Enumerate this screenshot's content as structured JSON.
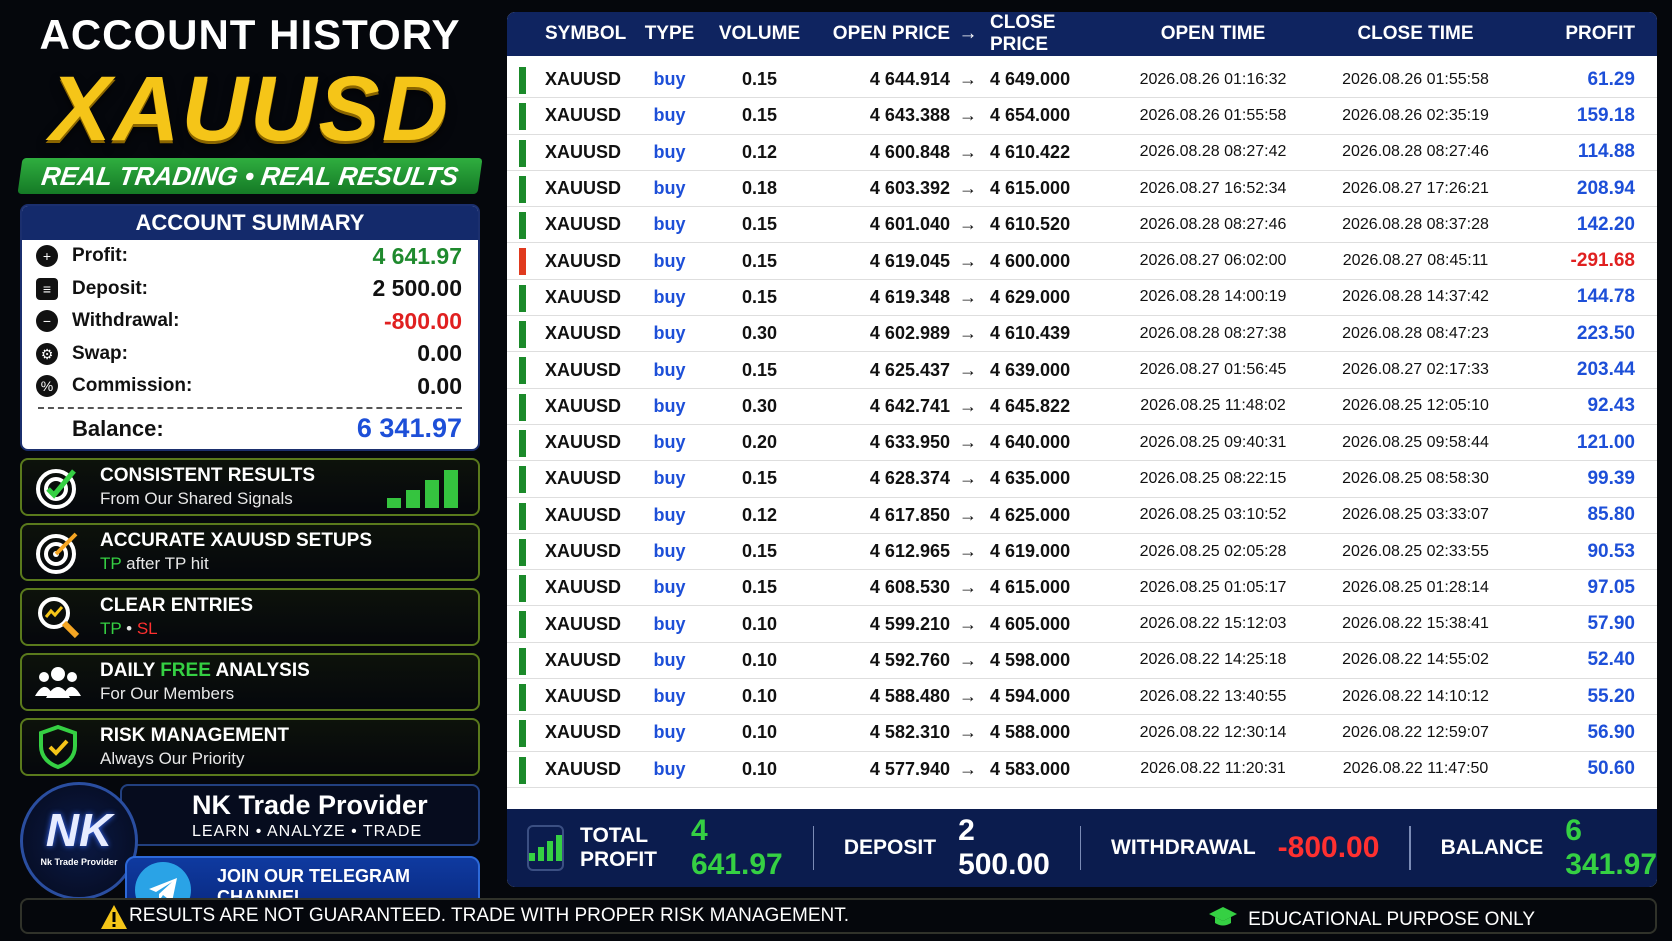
{
  "header": {
    "title": "ACCOUNT HISTORY",
    "symbol": "XAUUSD",
    "tagline": "REAL TRADING • REAL RESULTS"
  },
  "summary": {
    "heading": "ACCOUNT SUMMARY",
    "profit_label": "Profit:",
    "profit": "4 641.97",
    "deposit_label": "Deposit:",
    "deposit": "2 500.00",
    "withdrawal_label": "Withdrawal:",
    "withdrawal": "-800.00",
    "swap_label": "Swap:",
    "swap": "0.00",
    "commission_label": "Commission:",
    "commission": "0.00",
    "balance_label": "Balance:",
    "balance": "6 341.97"
  },
  "features": {
    "f1_title": "CONSISTENT RESULTS",
    "f1_sub": "From Our Shared Signals",
    "f2_title": "ACCURATE XAUUSD SETUPS",
    "f2_tp": "TP",
    "f2_sub": "after TP hit",
    "f3_title": "CLEAR ENTRIES",
    "f3_tp": "TP",
    "f3_dot": "•",
    "f3_sl": "SL",
    "f4_title_a": "DAILY",
    "f4_free": "FREE",
    "f4_title_b": "ANALYSIS",
    "f4_sub": "For Our Members",
    "f5_title": "RISK MANAGEMENT",
    "f5_sub": "Always Our Priority"
  },
  "brand": {
    "logo": "NK",
    "logo_sub": "Nk Trade Provider",
    "name": "NK Trade Provider",
    "slogan": "LEARN • ANALYZE • TRADE",
    "telegram_cta": "JOIN OUR TELEGRAM CHANNEL",
    "telegram_link": "t.me/NKlearnFX96"
  },
  "table": {
    "headers": {
      "symbol": "SYMBOL",
      "type": "TYPE",
      "volume": "VOLUME",
      "open_price": "OPEN PRICE",
      "arrow": "→",
      "close_price": "CLOSE PRICE",
      "open_time": "OPEN TIME",
      "close_time": "CLOSE TIME",
      "profit": "PROFIT"
    },
    "rows": [
      {
        "symbol": "XAUUSD",
        "type": "buy",
        "volume": "0.15",
        "open": "4 644.914",
        "close": "4 649.000",
        "open_time": "2026.08.26 01:16:32",
        "close_time": "2026.08.26 01:55:58",
        "profit": "61.29"
      },
      {
        "symbol": "XAUUSD",
        "type": "buy",
        "volume": "0.15",
        "open": "4 643.388",
        "close": "4 654.000",
        "open_time": "2026.08.26 01:55:58",
        "close_time": "2026.08.26 02:35:19",
        "profit": "159.18"
      },
      {
        "symbol": "XAUUSD",
        "type": "buy",
        "volume": "0.12",
        "open": "4 600.848",
        "close": "4 610.422",
        "open_time": "2026.08.28 08:27:42",
        "close_time": "2026.08.28 08:27:46",
        "profit": "114.88"
      },
      {
        "symbol": "XAUUSD",
        "type": "buy",
        "volume": "0.18",
        "open": "4 603.392",
        "close": "4 615.000",
        "open_time": "2026.08.27 16:52:34",
        "close_time": "2026.08.27 17:26:21",
        "profit": "208.94"
      },
      {
        "symbol": "XAUUSD",
        "type": "buy",
        "volume": "0.15",
        "open": "4 601.040",
        "close": "4 610.520",
        "open_time": "2026.08.28 08:27:46",
        "close_time": "2026.08.28 08:37:28",
        "profit": "142.20"
      },
      {
        "symbol": "XAUUSD",
        "type": "buy",
        "volume": "0.15",
        "open": "4 619.045",
        "close": "4 600.000",
        "open_time": "2026.08.27 06:02:00",
        "close_time": "2026.08.27 08:45:11",
        "profit": "-291.68"
      },
      {
        "symbol": "XAUUSD",
        "type": "buy",
        "volume": "0.15",
        "open": "4 619.348",
        "close": "4 629.000",
        "open_time": "2026.08.28 14:00:19",
        "close_time": "2026.08.28 14:37:42",
        "profit": "144.78"
      },
      {
        "symbol": "XAUUSD",
        "type": "buy",
        "volume": "0.30",
        "open": "4 602.989",
        "close": "4 610.439",
        "open_time": "2026.08.28 08:27:38",
        "close_time": "2026.08.28 08:47:23",
        "profit": "223.50"
      },
      {
        "symbol": "XAUUSD",
        "type": "buy",
        "volume": "0.15",
        "open": "4 625.437",
        "close": "4 639.000",
        "open_time": "2026.08.27 01:56:45",
        "close_time": "2026.08.27 02:17:33",
        "profit": "203.44"
      },
      {
        "symbol": "XAUUSD",
        "type": "buy",
        "volume": "0.30",
        "open": "4 642.741",
        "close": "4 645.822",
        "open_time": "2026.08.25 11:48:02",
        "close_time": "2026.08.25 12:05:10",
        "profit": "92.43"
      },
      {
        "symbol": "XAUUSD",
        "type": "buy",
        "volume": "0.20",
        "open": "4 633.950",
        "close": "4 640.000",
        "open_time": "2026.08.25 09:40:31",
        "close_time": "2026.08.25 09:58:44",
        "profit": "121.00"
      },
      {
        "symbol": "XAUUSD",
        "type": "buy",
        "volume": "0.15",
        "open": "4 628.374",
        "close": "4 635.000",
        "open_time": "2026.08.25 08:22:15",
        "close_time": "2026.08.25 08:58:30",
        "profit": "99.39"
      },
      {
        "symbol": "XAUUSD",
        "type": "buy",
        "volume": "0.12",
        "open": "4 617.850",
        "close": "4 625.000",
        "open_time": "2026.08.25 03:10:52",
        "close_time": "2026.08.25 03:33:07",
        "profit": "85.80"
      },
      {
        "symbol": "XAUUSD",
        "type": "buy",
        "volume": "0.15",
        "open": "4 612.965",
        "close": "4 619.000",
        "open_time": "2026.08.25 02:05:28",
        "close_time": "2026.08.25 02:33:55",
        "profit": "90.53"
      },
      {
        "symbol": "XAUUSD",
        "type": "buy",
        "volume": "0.15",
        "open": "4 608.530",
        "close": "4 615.000",
        "open_time": "2026.08.25 01:05:17",
        "close_time": "2026.08.25 01:28:14",
        "profit": "97.05"
      },
      {
        "symbol": "XAUUSD",
        "type": "buy",
        "volume": "0.10",
        "open": "4 599.210",
        "close": "4 605.000",
        "open_time": "2026.08.22 15:12:03",
        "close_time": "2026.08.22 15:38:41",
        "profit": "57.90"
      },
      {
        "symbol": "XAUUSD",
        "type": "buy",
        "volume": "0.10",
        "open": "4 592.760",
        "close": "4 598.000",
        "open_time": "2026.08.22 14:25:18",
        "close_time": "2026.08.22 14:55:02",
        "profit": "52.40"
      },
      {
        "symbol": "XAUUSD",
        "type": "buy",
        "volume": "0.10",
        "open": "4 588.480",
        "close": "4 594.000",
        "open_time": "2026.08.22 13:40:55",
        "close_time": "2026.08.22 14:10:12",
        "profit": "55.20"
      },
      {
        "symbol": "XAUUSD",
        "type": "buy",
        "volume": "0.10",
        "open": "4 582.310",
        "close": "4 588.000",
        "open_time": "2026.08.22 12:30:14",
        "close_time": "2026.08.22 12:59:07",
        "profit": "56.90"
      },
      {
        "symbol": "XAUUSD",
        "type": "buy",
        "volume": "0.10",
        "open": "4 577.940",
        "close": "4 583.000",
        "open_time": "2026.08.22 11:20:31",
        "close_time": "2026.08.22 11:47:50",
        "profit": "50.60"
      }
    ]
  },
  "totals": {
    "total_profit_label": "TOTAL PROFIT",
    "total_profit": "4 641.97",
    "deposit_label": "DEPOSIT",
    "deposit": "2 500.00",
    "withdrawal_label": "WITHDRAWAL",
    "withdrawal": "-800.00",
    "balance_label": "BALANCE",
    "balance": "6 341.97"
  },
  "footer": {
    "disclaimer": "RESULTS ARE NOT GUARANTEED. TRADE WITH PROPER RISK MANAGEMENT.",
    "edu": "EDUCATIONAL PURPOSE ONLY"
  },
  "colors": {
    "gold": "#f5c518",
    "green": "#35d043",
    "red": "#ff3030",
    "navy": "#0f2460",
    "blue": "#1d4fd8"
  }
}
